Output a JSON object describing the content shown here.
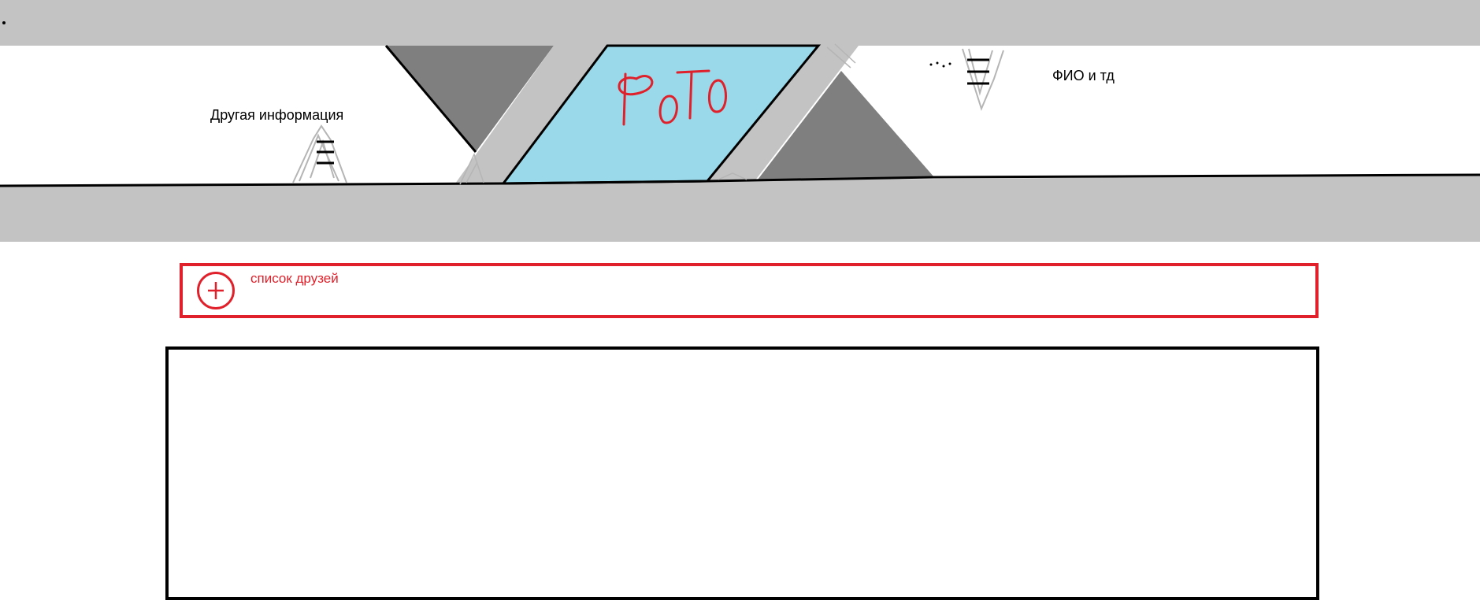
{
  "header": {
    "photo_label": "ФОТО",
    "fio_label": "ФИО и тд",
    "other_info_label": "Другая информация"
  },
  "friends": {
    "label": "список друзей",
    "add_icon": "plus-circle-icon"
  },
  "icons": {
    "menu": "hamburger-icon"
  },
  "colors": {
    "band_gray": "#c3c3c3",
    "triangle_gray": "#7f7f7f",
    "photo_blue": "#99d9ea",
    "accent_red": "#e0202a",
    "ink_black": "#000000"
  }
}
